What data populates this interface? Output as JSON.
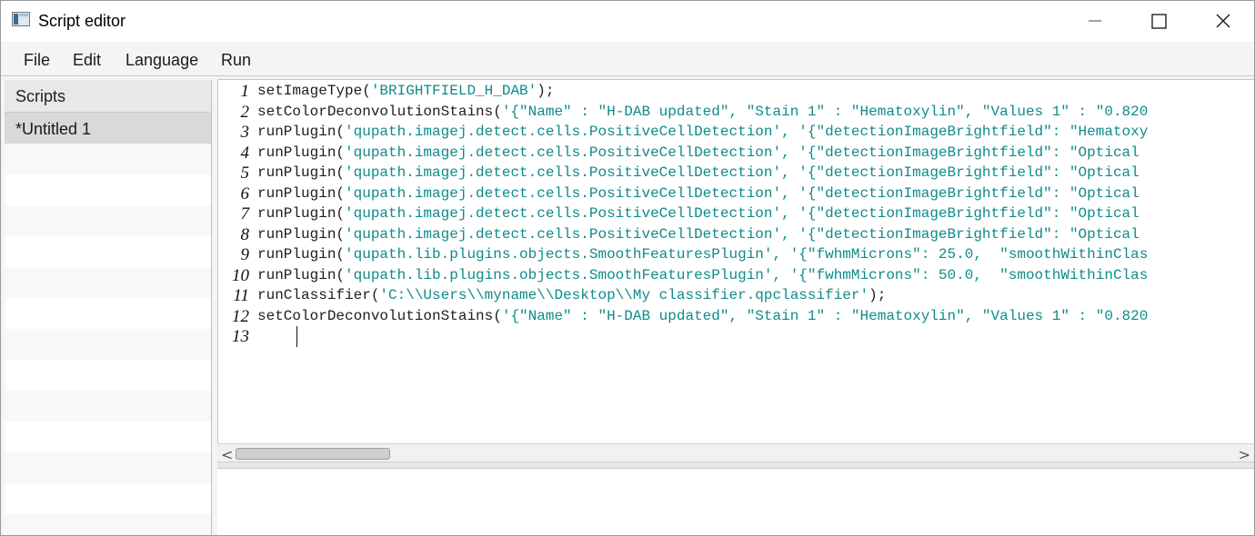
{
  "window": {
    "title": "Script editor",
    "icon": "app-window-icon"
  },
  "menu": {
    "file": "File",
    "edit": "Edit",
    "language": "Language",
    "run": "Run"
  },
  "sidebar": {
    "header": "Scripts",
    "items": [
      {
        "label": "*Untitled 1"
      }
    ]
  },
  "editor": {
    "lines": [
      {
        "n": "1",
        "fn": "setImageType",
        "args": "'BRIGHTFIELD_H_DAB'",
        "suffix": ");"
      },
      {
        "n": "2",
        "fn": "setColorDeconvolutionStains",
        "args": "'{\"Name\" : \"H-DAB updated\", \"Stain 1\" : \"Hematoxylin\", \"Values 1\" : \"0.820",
        "suffix": ""
      },
      {
        "n": "3",
        "fn": "runPlugin",
        "args": "'qupath.imagej.detect.cells.PositiveCellDetection', '{\"detectionImageBrightfield\": \"Hematoxy",
        "suffix": ""
      },
      {
        "n": "4",
        "fn": "runPlugin",
        "args": "'qupath.imagej.detect.cells.PositiveCellDetection', '{\"detectionImageBrightfield\": \"Optical ",
        "suffix": ""
      },
      {
        "n": "5",
        "fn": "runPlugin",
        "args": "'qupath.imagej.detect.cells.PositiveCellDetection', '{\"detectionImageBrightfield\": \"Optical ",
        "suffix": ""
      },
      {
        "n": "6",
        "fn": "runPlugin",
        "args": "'qupath.imagej.detect.cells.PositiveCellDetection', '{\"detectionImageBrightfield\": \"Optical ",
        "suffix": ""
      },
      {
        "n": "7",
        "fn": "runPlugin",
        "args": "'qupath.imagej.detect.cells.PositiveCellDetection', '{\"detectionImageBrightfield\": \"Optical ",
        "suffix": ""
      },
      {
        "n": "8",
        "fn": "runPlugin",
        "args": "'qupath.imagej.detect.cells.PositiveCellDetection', '{\"detectionImageBrightfield\": \"Optical ",
        "suffix": ""
      },
      {
        "n": "9",
        "fn": "runPlugin",
        "args": "'qupath.lib.plugins.objects.SmoothFeaturesPlugin', '{\"fwhmMicrons\": 25.0,  \"smoothWithinClas",
        "suffix": ""
      },
      {
        "n": "10",
        "fn": "runPlugin",
        "args": "'qupath.lib.plugins.objects.SmoothFeaturesPlugin', '{\"fwhmMicrons\": 50.0,  \"smoothWithinClas",
        "suffix": ""
      },
      {
        "n": "11",
        "fn": "runClassifier",
        "args": "'C:\\\\Users\\\\myname\\\\Desktop\\\\My classifier.qpclassifier'",
        "suffix": ");"
      },
      {
        "n": "12",
        "fn": "setColorDeconvolutionStains",
        "args": "'{\"Name\" : \"H-DAB updated\", \"Stain 1\" : \"Hematoxylin\", \"Values 1\" : \"0.820",
        "suffix": ""
      },
      {
        "n": "13",
        "fn": "",
        "args": "",
        "suffix": ""
      }
    ]
  },
  "scroll": {
    "left_arrow": "<",
    "right_arrow": ">"
  }
}
